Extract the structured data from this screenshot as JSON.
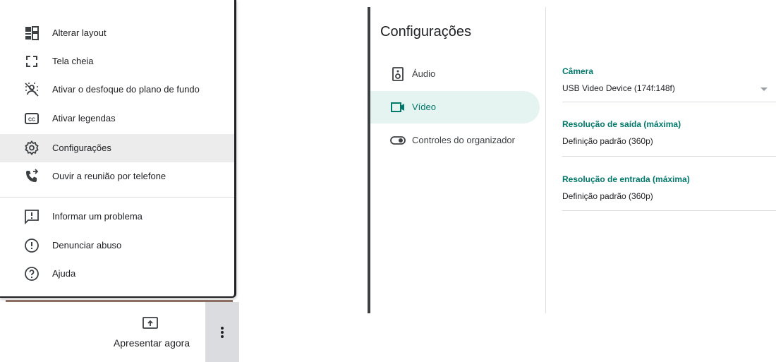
{
  "menu": {
    "items": [
      {
        "label": "Alterar layout",
        "icon": "layout-icon"
      },
      {
        "label": "Tela cheia",
        "icon": "fullscreen-icon"
      },
      {
        "label": "Ativar o desfoque do plano de fundo",
        "icon": "blur-background-icon"
      },
      {
        "label": "Ativar legendas",
        "icon": "captions-icon"
      },
      {
        "label": "Configurações",
        "icon": "gear-icon",
        "active": true
      },
      {
        "label": "Ouvir a reunião por telefone",
        "icon": "phone-forwarded-icon"
      },
      {
        "label": "Informar um problema",
        "icon": "feedback-icon"
      },
      {
        "label": "Denunciar abuso",
        "icon": "report-icon"
      },
      {
        "label": "Ajuda",
        "icon": "help-icon"
      }
    ]
  },
  "toolbar": {
    "present_label": "Apresentar agora",
    "present_icon": "present-screen-icon",
    "more_icon": "more-vert-icon"
  },
  "settings": {
    "title": "Configurações",
    "nav": [
      {
        "label": "Áudio",
        "icon": "speaker-icon"
      },
      {
        "label": "Vídeo",
        "icon": "videocam-icon",
        "active": true
      },
      {
        "label": "Controles do organizador",
        "icon": "toggle-icon"
      }
    ],
    "camera": {
      "label": "Câmera",
      "value": "USB Video Device (174f:148f)"
    },
    "output_resolution": {
      "label": "Resolução de saída (máxima)",
      "value": "Definição padrão (360p)"
    },
    "input_resolution": {
      "label": "Resolução de entrada (máxima)",
      "value": "Definição padrão (360p)"
    }
  },
  "colors": {
    "accent": "#00796b",
    "active_nav_bg": "#e6f4f1",
    "active_menu_bg": "#ececec"
  }
}
